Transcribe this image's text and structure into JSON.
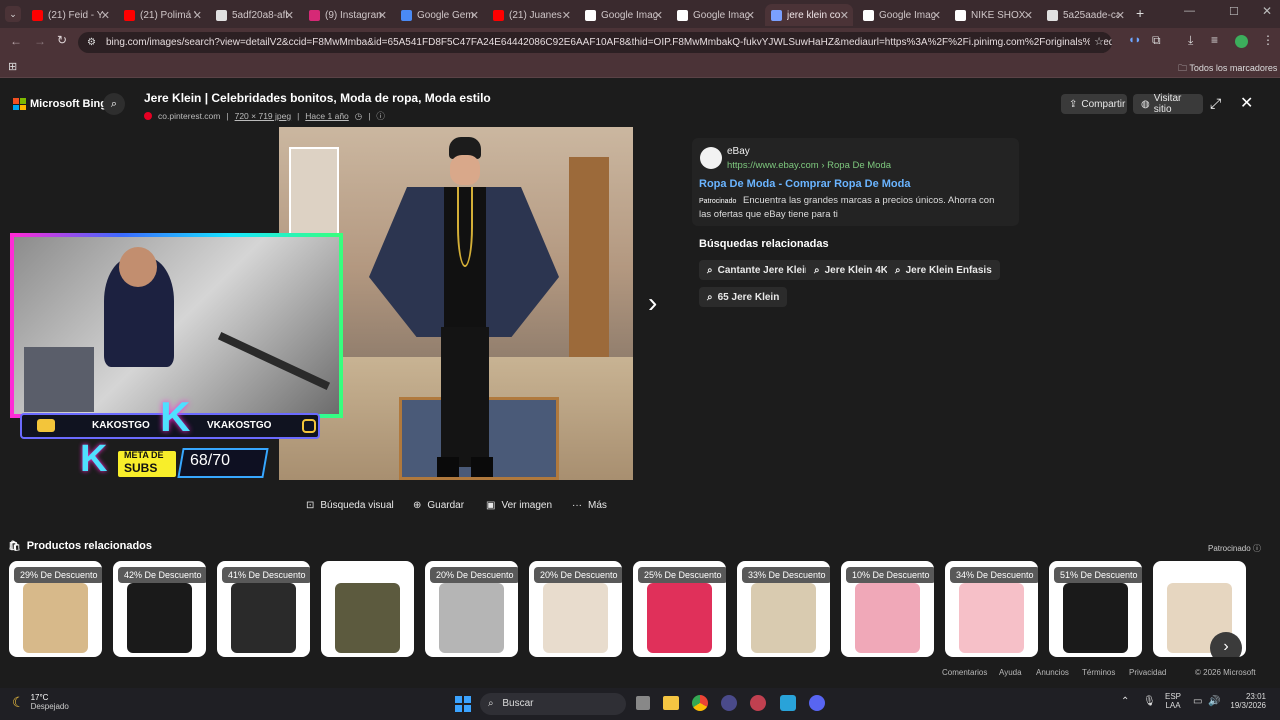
{
  "tabs": [
    {
      "label": "(21) Feid - Y",
      "color": "#ff0000"
    },
    {
      "label": "(21) Polimá Y",
      "color": "#ff0000"
    },
    {
      "label": "5adf20a8-afb",
      "color": "#e0e0e0"
    },
    {
      "label": "(9) Instagram",
      "color": "#d62976"
    },
    {
      "label": "Google Gemi",
      "color": "#4a8af4"
    },
    {
      "label": "(21) Juanes",
      "color": "#ff0000"
    },
    {
      "label": "Google Imag",
      "color": "#ffffff"
    },
    {
      "label": "Google Imag",
      "color": "#ffffff"
    },
    {
      "label": "jere klein co",
      "color": "#7aa0ff"
    },
    {
      "label": "Google Imag",
      "color": "#ffffff"
    },
    {
      "label": "NIKE SHOX",
      "color": "#ffffff"
    },
    {
      "label": "5a25aade-ca",
      "color": "#e0e0e0"
    }
  ],
  "url": "bing.com/images/search?view=detailV2&ccid=F8MwMmba&id=65A541FD8F5C47FA24E64442086C92E6AAF10AF8&thid=OIP.F8MwMmbakQ-fukvYJWLSuwHaHZ&mediaurl=https%3A%2F%2Fi.pinimg.com%2Foriginals%2Fed%2Faa%2F6...",
  "bookmarks_label": "Todos los marcadores",
  "bing": {
    "logo": "Microsoft Bing",
    "title": "Jere Klein | Celebridades bonitos, Moda de ropa, Moda estilo",
    "source": "co.pinterest.com",
    "size": "720 × 719 jpeg",
    "age": "Hace 1 año",
    "share": "Compartir",
    "visit": "Visitar sitio"
  },
  "overlay": {
    "left_name": "KAKOSTGO",
    "right_name": "VKAKOSTGO",
    "meta_line1": "META DE",
    "meta_line2": "SUBS",
    "count": "68/70"
  },
  "ad": {
    "name": "eBay",
    "url": "https://www.ebay.com › Ropa De Moda",
    "title": "Ropa De Moda - Comprar Ropa De Moda",
    "sponsored": "Patrocinado",
    "desc": "Encuentra las grandes marcas a precios únicos. Ahorra con las ofertas que eBay tiene para ti"
  },
  "related": {
    "heading": "Búsquedas relacionadas",
    "items": [
      "Cantante Jere Klein",
      "Jere Klein 4K",
      "Jere Klein Enfasis",
      "65 Jere Klein"
    ]
  },
  "actions": [
    "Búsqueda visual",
    "Guardar",
    "Ver imagen",
    "Más"
  ],
  "products": {
    "heading": "Productos relacionados",
    "sponsored": "Patrocinado",
    "items": [
      {
        "badge": "29% De Descuento",
        "bg": "#d7b98a"
      },
      {
        "badge": "42% De Descuento",
        "bg": "#1a1a1a"
      },
      {
        "badge": "41% De Descuento",
        "bg": "#2a2a2a"
      },
      {
        "badge": "",
        "bg": "#5c5a3e"
      },
      {
        "badge": "20% De Descuento",
        "bg": "#b5b5b5"
      },
      {
        "badge": "20% De Descuento",
        "bg": "#e8dccd"
      },
      {
        "badge": "25% De Descuento",
        "bg": "#e0305a"
      },
      {
        "badge": "33% De Descuento",
        "bg": "#d9cbb0"
      },
      {
        "badge": "10% De Descuento",
        "bg": "#f0a8b8"
      },
      {
        "badge": "34% De Descuento",
        "bg": "#f6c0c8"
      },
      {
        "badge": "51% De Descuento",
        "bg": "#1a1a1a"
      },
      {
        "badge": "",
        "bg": "#e6d6c0"
      }
    ]
  },
  "footer": {
    "links": [
      "Comentarios",
      "Ayuda",
      "Anuncios",
      "Términos",
      "Privacidad"
    ],
    "copyright": "© 2026 Microsoft"
  },
  "taskbar": {
    "temp": "17°C",
    "weather": "Despejado",
    "search": "Buscar",
    "lang1": "ESP",
    "lang2": "LAA",
    "time": "23:01",
    "date": "19/3/2026"
  }
}
